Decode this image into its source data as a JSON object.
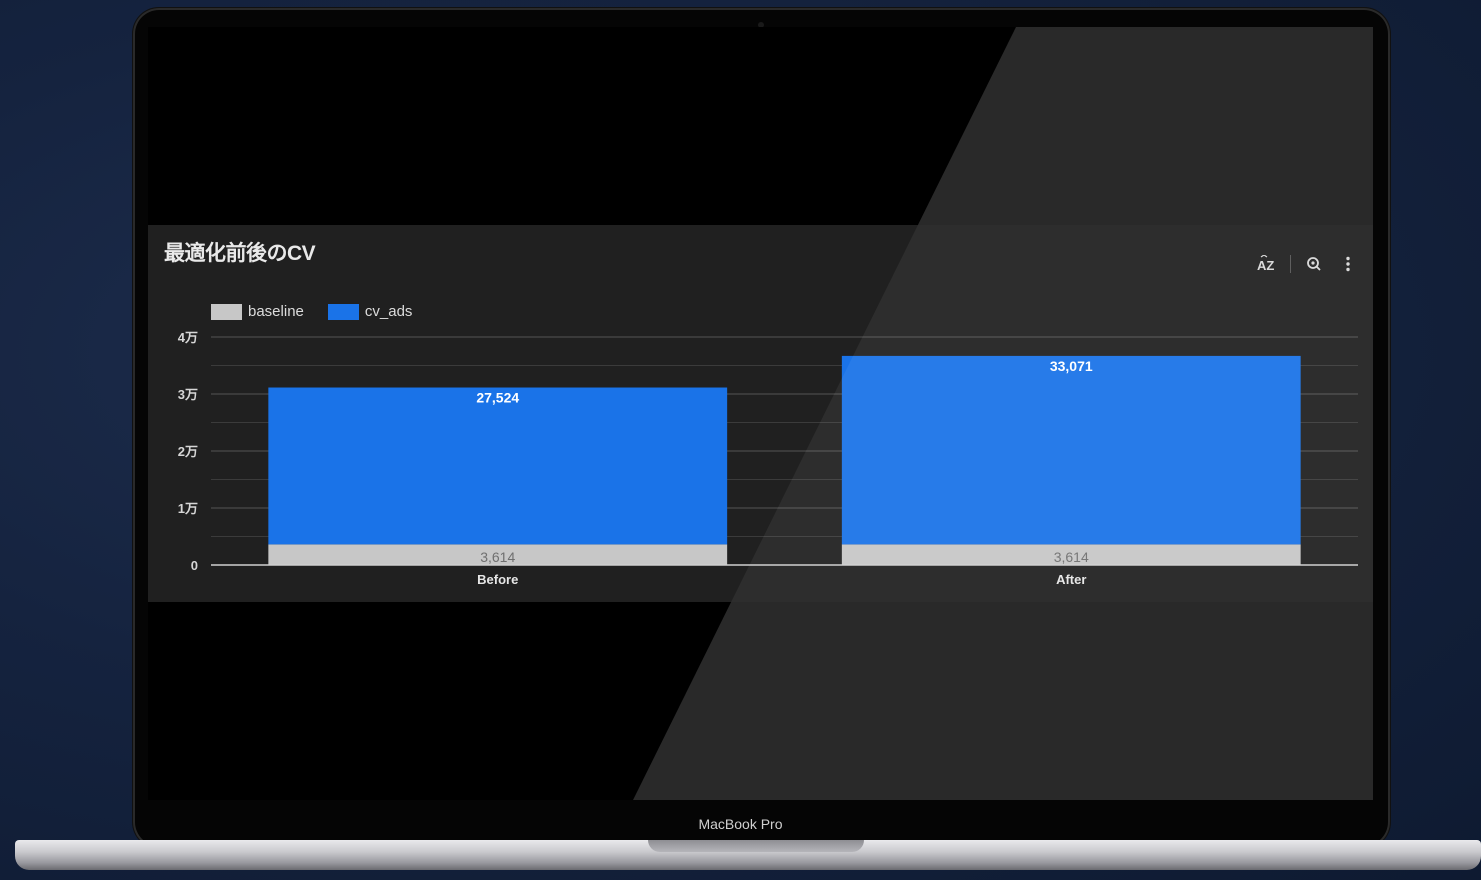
{
  "device": {
    "label": "MacBook Pro"
  },
  "chart_data": {
    "type": "bar",
    "stacked": true,
    "title": "最適化前後のCV",
    "categories": [
      "Before",
      "After"
    ],
    "series": [
      {
        "name": "baseline",
        "color": "#c7c7c7",
        "values": [
          3614,
          3614
        ],
        "labels": [
          "3,614",
          "3,614"
        ]
      },
      {
        "name": "cv_ads",
        "color": "#1a73e8",
        "values": [
          27524,
          33071
        ],
        "labels": [
          "27,524",
          "33,071"
        ]
      }
    ],
    "ylim": [
      0,
      40000
    ],
    "yticks": [
      0,
      10000,
      20000,
      30000,
      40000
    ],
    "ytick_labels": [
      "0",
      "1万",
      "2万",
      "3万",
      "4万"
    ],
    "grid": true,
    "legend_position": "top-left"
  },
  "toolbar": {
    "sort_icon": "sort-az-icon",
    "zoom_icon": "zoom-icon",
    "more_icon": "more-vert-icon"
  }
}
